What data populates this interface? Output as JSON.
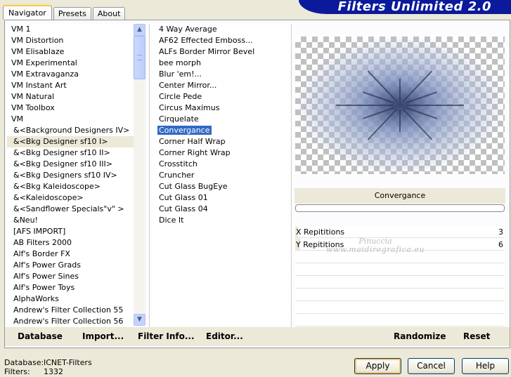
{
  "window": {
    "title": "Filters Unlimited 2.0"
  },
  "tabs": [
    {
      "label": "Navigator",
      "active": true
    },
    {
      "label": "Presets",
      "active": false
    },
    {
      "label": "About",
      "active": false
    }
  ],
  "categories": [
    "VM 1",
    "VM Distortion",
    "VM Elisablaze",
    "VM Experimental",
    "VM Extravaganza",
    "VM Instant Art",
    "VM Natural",
    "VM Toolbox",
    "VM",
    "&<Background Designers IV>",
    "&<Bkg Designer sf10 I>",
    "&<Bkg Designer sf10 II>",
    "&<Bkg Designer sf10 III>",
    "&<Bkg Designers sf10 IV>",
    "&<Bkg Kaleidoscope>",
    "&<Kaleidoscope>",
    "&<Sandflower Specials\"v\" >",
    "&Neu!",
    "[AFS IMPORT]",
    "AB Filters 2000",
    "Alf's Border FX",
    "Alf's Power Grads",
    "Alf's Power Sines",
    "Alf's Power Toys",
    "AlphaWorks",
    "Andrew's Filter Collection 55",
    "Andrew's Filter Collection 56"
  ],
  "selected_category": "&<Bkg Designer sf10 I>",
  "filters": [
    "4 Way Average",
    "AF62 Effected Emboss...",
    "ALFs Border Mirror Bevel",
    "bee morph",
    "Blur 'em!...",
    "Center Mirror...",
    "Circle Pede",
    "Circus Maximus",
    "Cirquelate",
    "Convergance",
    "Corner Half Wrap",
    "Corner Right Wrap",
    "Crosstitch",
    "Cruncher",
    "Cut Glass  BugEye",
    "Cut Glass 01",
    "Cut Glass 04",
    "Dice It"
  ],
  "selected_filter": "Convergance",
  "preview": {
    "filter_name": "Convergance",
    "progress_pct": 0
  },
  "parameters": [
    {
      "label": "X Repititions",
      "value": "3",
      "level": 0.012
    },
    {
      "label": "Y Repititions",
      "value": "6",
      "level": 0.024
    }
  ],
  "watermark": {
    "line1": "Pinuccia",
    "line2": "www.maidiregrafica.eu"
  },
  "toolbar": {
    "database": "Database",
    "import": "Import...",
    "filter_info": "Filter Info...",
    "editor": "Editor...",
    "randomize": "Randomize",
    "reset": "Reset"
  },
  "status": {
    "database_label": "Database:",
    "database_value": "ICNET-Filters",
    "filters_label": "Filters:",
    "filters_value": "1332"
  },
  "buttons": {
    "apply": "Apply",
    "cancel": "Cancel",
    "help": "Help"
  },
  "colors": {
    "banner": "#0a1a9a",
    "selection": "#316ac5",
    "dialog_bg": "#ece9d8"
  },
  "icons": {
    "scroll_up": "chevron-up-icon",
    "scroll_down": "chevron-down-icon"
  }
}
